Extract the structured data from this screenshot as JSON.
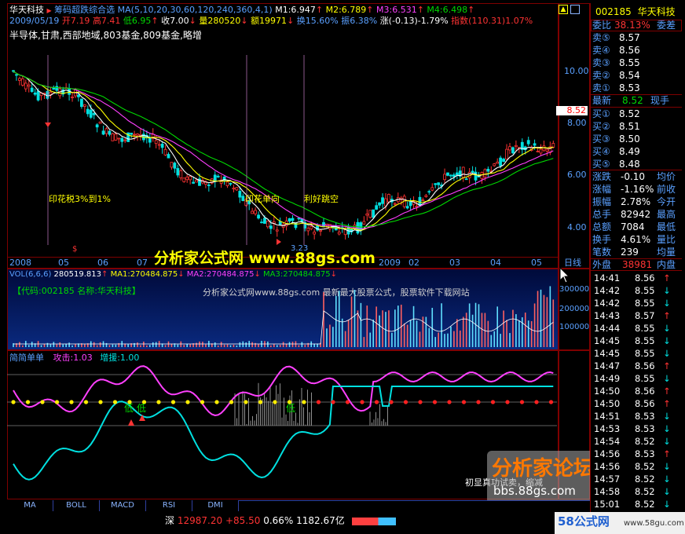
{
  "header": {
    "stock_name": "华天科技",
    "formula_name": "筹码超跌综合选",
    "ma_params": "MA(5,10,20,30,60,120,240,360,4,1)",
    "m1": "M1:6.947",
    "m2": "M2:6.789",
    "m3": "M3:6.531",
    "m4": "M4:6.498",
    "date": "2009/05/19",
    "open": "开7.19",
    "high": "高7.41",
    "low": "低6.95",
    "close": "收7.00",
    "vol": "量280520",
    "amount": "额19971",
    "turnover": "换15.60%",
    "amplitude": "振6.38%",
    "change": "涨(-0.13)-1.79%",
    "index": "指数(110.31)1.07%",
    "concepts": "半导体,甘肃,西部地域,803基金,809基金,略增"
  },
  "price_axis": [
    "10.00",
    "8.00",
    "6.00",
    "4.00"
  ],
  "price_tag": "8.52",
  "annotations": [
    "印花税3%到1%",
    "印花单向",
    "利好跳空"
  ],
  "low_label": "3.23",
  "time_axis": [
    "2008",
    "05",
    "06",
    "07",
    "2009",
    "02",
    "03",
    "04",
    "05",
    "日线"
  ],
  "watermark1": "分析家公式网 www.88gs.com",
  "watermark2": "分析家论坛",
  "watermark2_url": "bbs.88gs.com",
  "watermark3": "58公式网",
  "watermark3_url": "www.58gu.com",
  "vol_panel": {
    "title": "VOL(6,6,6)",
    "v": "280519.813",
    "ma1": "MA1:270484.875",
    "ma2": "MA2:270484.875",
    "ma3": "MA3:270484.875",
    "code_label": "【代码:002185 名称:华天科技】",
    "ad": "分析家公式网www.88gs.com 最新最大股票公式，股票软件下载网站",
    "axis": [
      "300000",
      "200000",
      "100000"
    ]
  },
  "ind_panel": {
    "title": "简简单单",
    "attack": "攻击:1.03",
    "hold": "增援:1.00",
    "labels": [
      "低",
      "低",
      "低"
    ],
    "note": "初显真功试卖，缩减"
  },
  "tabs": [
    "MA",
    "BOLL",
    "MACD",
    "RSI",
    "DMI"
  ],
  "status": {
    "market": "深",
    "index": "12987.20",
    "delta": "+85.50",
    "pct": "0.66%",
    "amount": "1182.67亿"
  },
  "side": {
    "code": "002185",
    "name": "华天科技",
    "wei_bi_label": "委比",
    "wei_bi": "38.13%",
    "wei_cha_label": "委差",
    "asks": [
      {
        "label": "卖⑤",
        "price": "8.57"
      },
      {
        "label": "卖④",
        "price": "8.56"
      },
      {
        "label": "卖③",
        "price": "8.55"
      },
      {
        "label": "卖②",
        "price": "8.54"
      },
      {
        "label": "卖①",
        "price": "8.53"
      }
    ],
    "last_label": "最新",
    "last": "8.52",
    "xianshou": "现手",
    "bids": [
      {
        "label": "买①",
        "price": "8.52"
      },
      {
        "label": "买②",
        "price": "8.51"
      },
      {
        "label": "买③",
        "price": "8.50"
      },
      {
        "label": "买④",
        "price": "8.49"
      },
      {
        "label": "买⑤",
        "price": "8.48"
      }
    ],
    "stats": [
      {
        "a": "涨跌",
        "v": "-0.10",
        "b": "均价"
      },
      {
        "a": "涨幅",
        "v": "-1.16%",
        "b": "前收"
      },
      {
        "a": "振幅",
        "v": "2.78%",
        "b": "今开"
      },
      {
        "a": "总手",
        "v": "82942",
        "b": "最高"
      },
      {
        "a": "总额",
        "v": "7084",
        "b": "最低"
      },
      {
        "a": "换手",
        "v": "4.61%",
        "b": "量比"
      },
      {
        "a": "笔数",
        "v": "239",
        "b": "均量"
      }
    ],
    "waipan_label": "外盘",
    "waipan": "38981",
    "neipan_label": "内盘",
    "ticks": [
      {
        "t": "14:41",
        "p": "8.56",
        "d": "↑"
      },
      {
        "t": "14:42",
        "p": "8.55",
        "d": "↓"
      },
      {
        "t": "14:42",
        "p": "8.55",
        "d": "↓"
      },
      {
        "t": "14:43",
        "p": "8.57",
        "d": "↑"
      },
      {
        "t": "14:44",
        "p": "8.55",
        "d": "↓"
      },
      {
        "t": "14:45",
        "p": "8.55",
        "d": "↓"
      },
      {
        "t": "14:45",
        "p": "8.55",
        "d": "↓"
      },
      {
        "t": "14:47",
        "p": "8.56",
        "d": "↑"
      },
      {
        "t": "14:49",
        "p": "8.55",
        "d": "↓"
      },
      {
        "t": "14:50",
        "p": "8.56",
        "d": "↑"
      },
      {
        "t": "14:50",
        "p": "8.56",
        "d": "↑"
      },
      {
        "t": "14:51",
        "p": "8.53",
        "d": "↓"
      },
      {
        "t": "14:53",
        "p": "8.53",
        "d": "↓"
      },
      {
        "t": "14:54",
        "p": "8.52",
        "d": "↓"
      },
      {
        "t": "14:56",
        "p": "8.53",
        "d": "↑"
      },
      {
        "t": "14:56",
        "p": "8.52",
        "d": "↓"
      },
      {
        "t": "14:57",
        "p": "8.52",
        "d": "↓"
      },
      {
        "t": "14:58",
        "p": "8.52",
        "d": "↓"
      },
      {
        "t": "15:01",
        "p": "8.52",
        "d": "↓"
      }
    ]
  },
  "colors": {
    "bg": "#000000",
    "up": "#ff3333",
    "down": "#00e0e0",
    "ma5": "#ffffff",
    "ma10": "#ffff00",
    "ma20": "#ff40ff",
    "ma30": "#00d800",
    "frame": "#7f0000"
  }
}
